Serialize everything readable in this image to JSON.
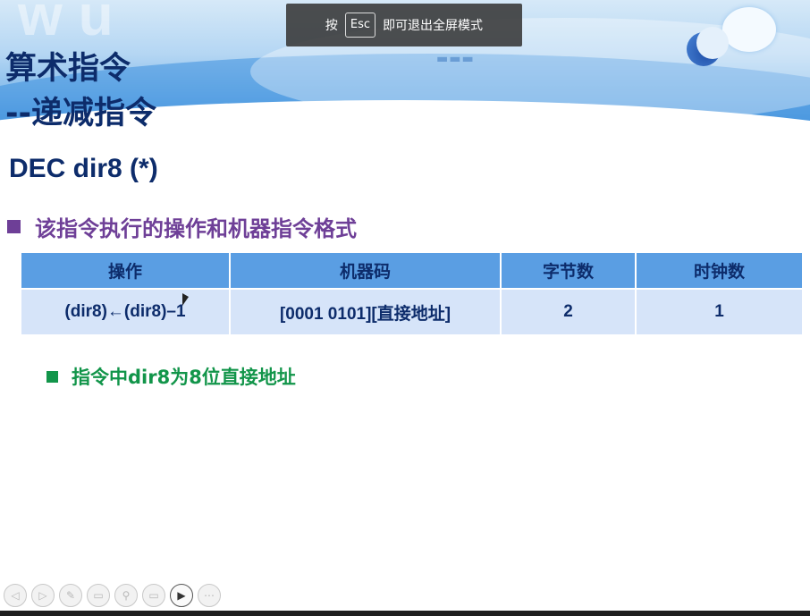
{
  "slide": {
    "title_line1": "算术指令",
    "title_line2": "--递减指令",
    "subtitle": "DEC dir8   (*)",
    "bullet1": "该指令执行的操作和机器指令格式",
    "bullet2": "指令中dir8为8位直接地址",
    "table": {
      "headers": [
        "操作",
        "机器码",
        "字节数",
        "时钟数"
      ],
      "row": [
        "(dir8)←(dir8)–1",
        "[0001 0101][直接地址]",
        "2",
        "1"
      ]
    }
  },
  "fullscreen_toast": {
    "prefix": "按",
    "key": "Esc",
    "suffix": "即可退出全屏模式"
  },
  "toolbar": {
    "buttons": [
      {
        "icon": "previous-icon",
        "glyph": "◁"
      },
      {
        "icon": "next-icon",
        "glyph": "▷"
      },
      {
        "icon": "pen-icon",
        "glyph": "✎"
      },
      {
        "icon": "slides-icon",
        "glyph": "▭"
      },
      {
        "icon": "zoom-icon",
        "glyph": "⚲"
      },
      {
        "icon": "subtitle-icon",
        "glyph": "▭"
      },
      {
        "icon": "camera-icon",
        "glyph": "▶"
      },
      {
        "icon": "more-icon",
        "glyph": "⋯"
      }
    ]
  },
  "colors": {
    "title": "#0d2c6b",
    "bullet_purple": "#6e3f97",
    "bullet_green": "#12954a",
    "table_header": "#5a9ee3",
    "table_row": "#d6e4f9"
  }
}
